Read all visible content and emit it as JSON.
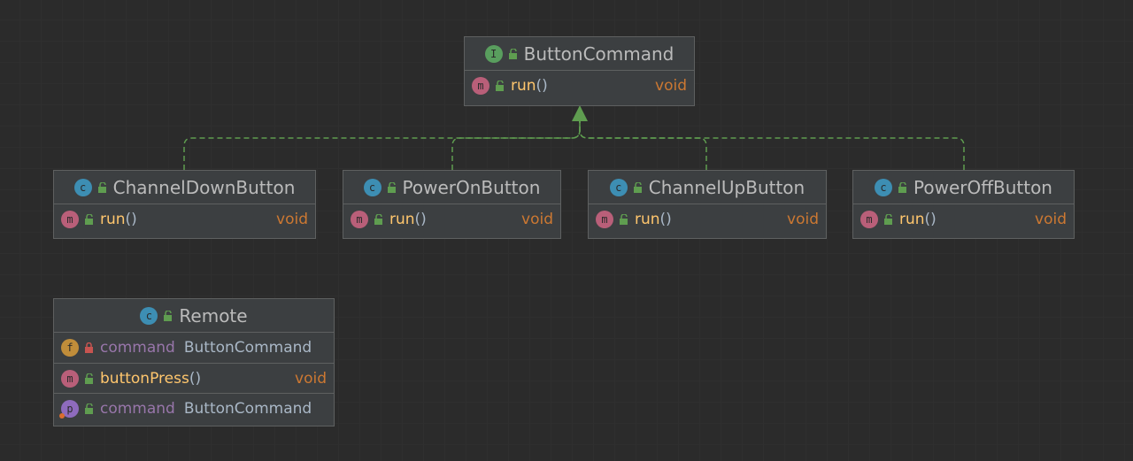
{
  "diagram": {
    "interface": {
      "kind_icon": "I",
      "name": "ButtonCommand",
      "method": {
        "icon": "m",
        "name": "run",
        "parens": "()",
        "type": "void"
      }
    },
    "implementations": [
      {
        "kind_icon": "c",
        "name": "ChannelDownButton",
        "method": {
          "icon": "m",
          "name": "run",
          "parens": "()",
          "type": "void"
        }
      },
      {
        "kind_icon": "c",
        "name": "PowerOnButton",
        "method": {
          "icon": "m",
          "name": "run",
          "parens": "()",
          "type": "void"
        }
      },
      {
        "kind_icon": "c",
        "name": "ChannelUpButton",
        "method": {
          "icon": "m",
          "name": "run",
          "parens": "()",
          "type": "void"
        }
      },
      {
        "kind_icon": "c",
        "name": "PowerOffButton",
        "method": {
          "icon": "m",
          "name": "run",
          "parens": "()",
          "type": "void"
        }
      }
    ],
    "remote": {
      "kind_icon": "c",
      "name": "Remote",
      "field": {
        "icon": "f",
        "name": "command",
        "type": "ButtonCommand"
      },
      "method": {
        "icon": "m",
        "name": "buttonPress",
        "parens": "()",
        "type": "void"
      },
      "property": {
        "icon": "p",
        "name": "command",
        "type": "ButtonCommand"
      }
    }
  },
  "colors": {
    "background": "#2b2b2b",
    "node": "#3c3f41",
    "edge": "#5f9d50",
    "method_name": "#ffc66d",
    "keyword": "#cc7832",
    "field_name": "#9876aa"
  }
}
